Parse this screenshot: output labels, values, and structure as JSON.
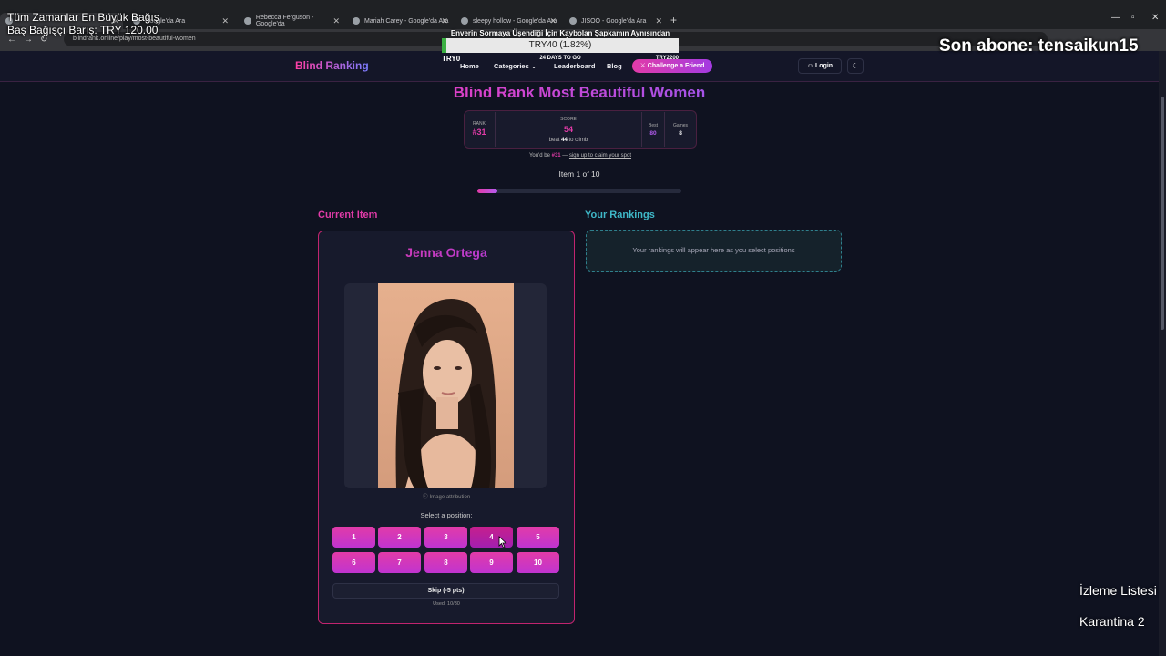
{
  "browser": {
    "tabs": [
      {
        "label": "Tüm Zamanlar En Büyük Bağış"
      },
      {
        "label": "Google'da Ara"
      },
      {
        "label": "Rebecca Ferguson - Google'da"
      },
      {
        "label": "Mariah Carey - Google'da Ara"
      },
      {
        "label": "sleepy hollow - Google'da Ara"
      },
      {
        "label": "JISOO - Google'da Ara"
      }
    ],
    "url": "blindrank.online/play/most-beautiful-women"
  },
  "overlays": {
    "top_left_line1": "Tüm Zamanlar En Büyük Bağış",
    "top_left_line2": "Baş Bağışçı Barış: TRY 120.00",
    "goal_title": "Enverin Sormaya Üşendiği İçin Kaybolan Şapkamın Aynısından Almak İçin",
    "goal_value": "TRY40 (1.82%)",
    "goal_progress_fraction": 0.0182,
    "goal_start": "TRY0",
    "goal_days": "24 DAYS TO GO",
    "goal_target": "TRY2200",
    "last_subscriber": "Son abone: tensaikun15",
    "watchlist": "İzleme Listesi",
    "quarantine": "Karantina 2"
  },
  "nav": {
    "logo": "Blind Ranking",
    "home": "Home",
    "categories": "Categories",
    "leaderboard": "Leaderboard",
    "blog": "Blog",
    "challenge": "⚔ Challenge a Friend",
    "login": "Login",
    "theme_icon": "☾"
  },
  "game": {
    "title": "Blind Rank Most Beautiful Women",
    "rank_label": "RANK",
    "rank_value": "#31",
    "score_label": "SCORE",
    "score_value": "54",
    "beat_prefix": "beat",
    "beat_value": "44",
    "beat_suffix": "to climb",
    "best_label": "Best",
    "best_value": "80",
    "games_label": "Games",
    "games_value": "8",
    "claim_prefix": "You'd be",
    "claim_rank": "#31",
    "claim_dash": "—",
    "claim_link": "sign up to claim your spot",
    "item_counter": "Item 1 of 10",
    "progress_fraction": 0.1,
    "current_heading": "Current Item",
    "rankings_heading": "Your Rankings",
    "item_name": "Jenna Ortega",
    "attribution": "ⓘ Image attribution",
    "select_label": "Select a position:",
    "positions": [
      "1",
      "2",
      "3",
      "4",
      "5",
      "6",
      "7",
      "8",
      "9",
      "10"
    ],
    "hovered_position": "4",
    "skip_label": "Skip (-5 pts)",
    "used_label": "Used: 10/30",
    "rankings_empty": "Your rankings will appear here as you select positions"
  }
}
